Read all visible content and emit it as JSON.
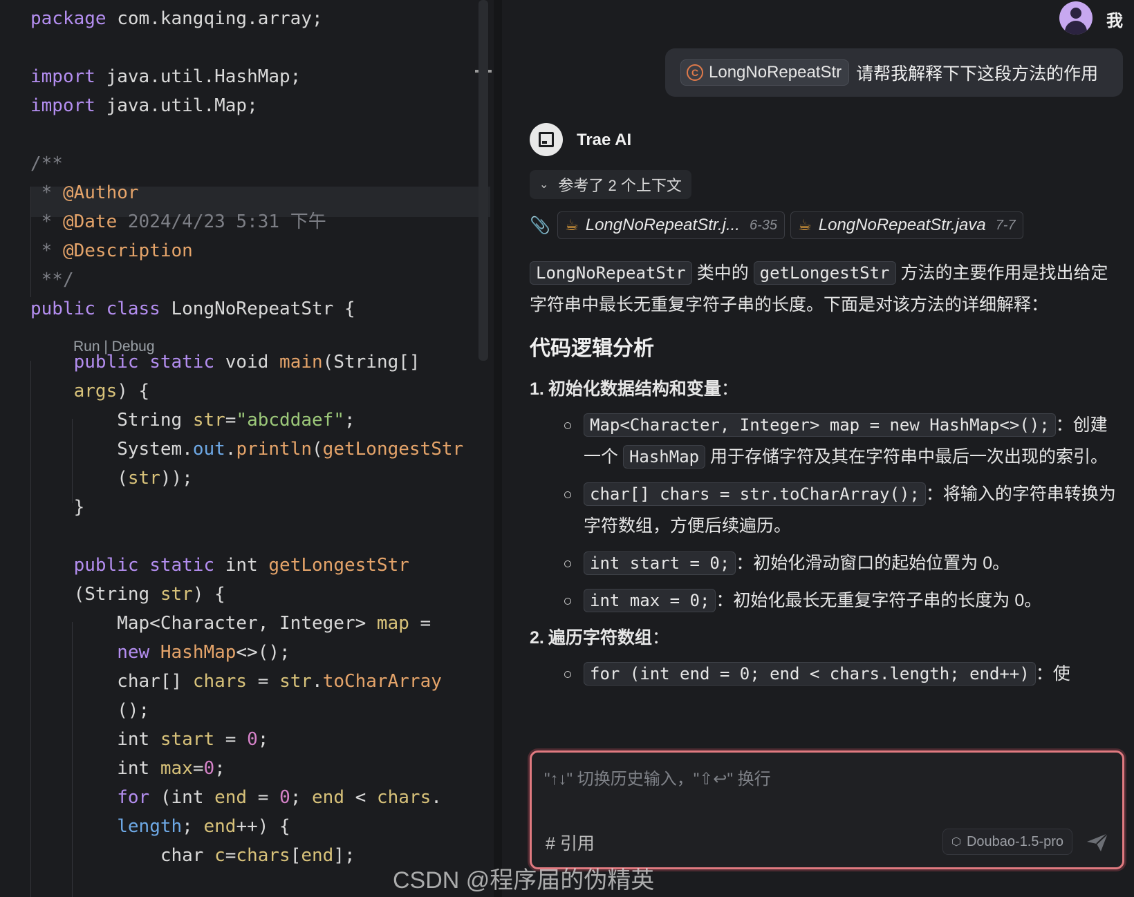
{
  "editor": {
    "code_lens": {
      "run": "Run",
      "separator": " | ",
      "debug": "Debug"
    }
  },
  "chat": {
    "user": {
      "name": "我",
      "file_chip": "LongNoRepeatStr",
      "message": "请帮我解释下下这段方法的作用"
    },
    "ai": {
      "name": "Trae AI"
    },
    "context": {
      "toggle_label": "参考了 2 个上下文",
      "files": [
        {
          "name": "LongNoRepeatStr.j...",
          "range": "6-35"
        },
        {
          "name": "LongNoRepeatStr.java",
          "range": "7-7"
        }
      ]
    },
    "answer": {
      "intro_code1": "LongNoRepeatStr",
      "intro_text1": " 类中的 ",
      "intro_code2": "getLongestStr",
      "intro_text2": " 方法的主要作用是找出给定字符串中最长无重复字符子串的长度。下面是对该方法的详细解释：",
      "heading": "代码逻辑分析",
      "sections": [
        {
          "number": "1.",
          "title": "初始化数据结构和变量",
          "suffix": "：",
          "bullets": [
            {
              "code": "Map<Character, Integer> map = new HashMap<>();",
              "pre": "：创建一个 ",
              "code2": "HashMap",
              "post": " 用于存储字符及其在字符串中最后一次出现的索引。"
            },
            {
              "code": "char[] chars = str.toCharArray();",
              "pre": "：将输入的字符串转换为字符数组，方便后续遍历。",
              "code2": "",
              "post": ""
            },
            {
              "code": "int start = 0;",
              "pre": "：初始化滑动窗口的起始位置为 0。",
              "code2": "",
              "post": ""
            },
            {
              "code": "int max = 0;",
              "pre": "：初始化最长无重复字符子串的长度为 0。",
              "code2": "",
              "post": ""
            }
          ]
        },
        {
          "number": "2.",
          "title": "遍历字符数组",
          "suffix": "：",
          "bullets": [
            {
              "code": "for (int end = 0; end < chars.length; end++)",
              "pre": "：使",
              "code2": "",
              "post": ""
            }
          ]
        }
      ]
    },
    "input": {
      "placeholder": "\"↑↓\" 切换历史输入，\"⇧↩\" 换行",
      "value": "",
      "ref_label": "# 引用",
      "model": "Doubao-1.5-pro"
    }
  },
  "watermark": "CSDN @程序届的伪精英",
  "colors": {
    "accent_border": "#e07a80",
    "keyword": "#b48ef0",
    "function": "#e5a46a",
    "string": "#9dc97a"
  }
}
